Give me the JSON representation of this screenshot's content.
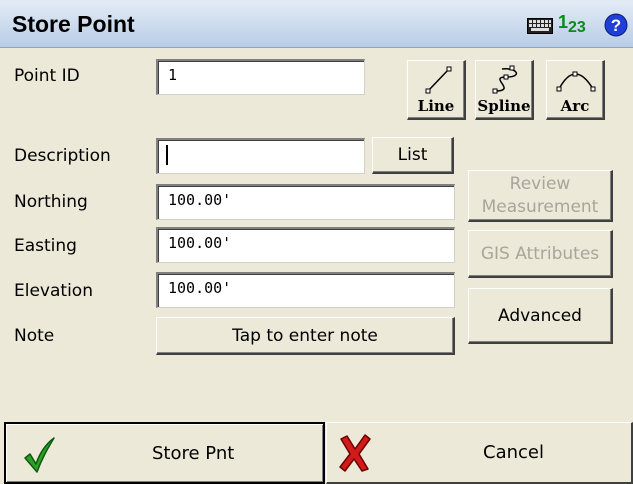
{
  "window": {
    "title": "Store Point"
  },
  "titlebar_icons": {
    "numeric_main": "1",
    "numeric_sub": "2",
    "numeric_sub2": "3"
  },
  "fields": {
    "point_id": {
      "label": "Point ID",
      "value": "1"
    },
    "description": {
      "label": "Description",
      "value": ""
    },
    "northing": {
      "label": "Northing",
      "value": "100.00'"
    },
    "easting": {
      "label": "Easting",
      "value": "100.00'"
    },
    "elevation": {
      "label": "Elevation",
      "value": "100.00'"
    },
    "note": {
      "label": "Note",
      "button": "Tap to enter note"
    }
  },
  "geometry_buttons": {
    "line": "Line",
    "spline": "Spline",
    "arc": "Arc"
  },
  "buttons": {
    "list": "List",
    "review_line1": "Review",
    "review_line2": "Measurement",
    "gis_attributes": "GIS Attributes",
    "advanced": "Advanced",
    "store": "Store Pnt",
    "cancel": "Cancel"
  },
  "colors": {
    "titlebar": "#b8cde6",
    "background": "#ece9d8",
    "numeric_green": "#0a8a1a",
    "help_blue": "#1f3fd6",
    "disabled_text": "#a8a59a"
  }
}
